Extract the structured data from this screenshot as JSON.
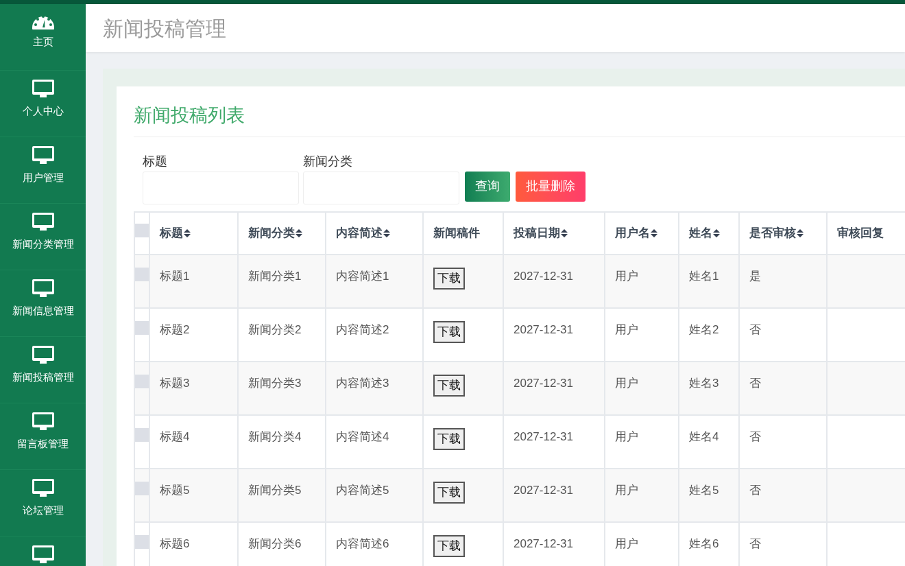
{
  "sidebar": {
    "items": [
      {
        "kind": "dashboard",
        "label": "主页"
      },
      {
        "kind": "monitor",
        "label": "个人中心"
      },
      {
        "kind": "monitor",
        "label": "用户管理"
      },
      {
        "kind": "monitor",
        "label": "新闻分类管理"
      },
      {
        "kind": "monitor",
        "label": "新闻信息管理"
      },
      {
        "kind": "monitor",
        "label": "新闻投稿管理"
      },
      {
        "kind": "monitor",
        "label": "留言板管理"
      },
      {
        "kind": "monitor",
        "label": "论坛管理"
      },
      {
        "kind": "monitor"
      }
    ]
  },
  "header": {
    "title": "新闻投稿管理"
  },
  "card": {
    "title": "新闻投稿列表",
    "filters": [
      {
        "label": "标题"
      },
      {
        "label": "新闻分类"
      }
    ],
    "buttons": [
      {
        "kind": "search",
        "label": "查询"
      },
      {
        "kind": "danger",
        "label": "批量删除"
      }
    ],
    "table": {
      "select_all": {
        "checked": false
      },
      "columns": [
        {
          "label": "标题",
          "sortable": true
        },
        {
          "label": "新闻分类",
          "sortable": true
        },
        {
          "label": "内容简述",
          "sortable": true
        },
        {
          "label": "新闻稿件",
          "sortable": false
        },
        {
          "label": "投稿日期",
          "sortable": true
        },
        {
          "label": "用户名",
          "sortable": true
        },
        {
          "label": "姓名",
          "sortable": true
        },
        {
          "label": "是否审核",
          "sortable": true
        },
        {
          "label": "审核回复",
          "sortable": false
        }
      ],
      "rows": [
        {
          "checked": false,
          "cells": [
            "标题1",
            "新闻分类1",
            "内容简述1",
            {
              "button": "下载"
            },
            "2027-12-31",
            "用户",
            "姓名1",
            "是"
          ]
        },
        {
          "checked": false,
          "cells": [
            "标题2",
            "新闻分类2",
            "内容简述2",
            {
              "button": "下载"
            },
            "2027-12-31",
            "用户",
            "姓名2",
            "否"
          ]
        },
        {
          "checked": false,
          "cells": [
            "标题3",
            "新闻分类3",
            "内容简述3",
            {
              "button": "下载"
            },
            "2027-12-31",
            "用户",
            "姓名3",
            "否"
          ]
        },
        {
          "checked": false,
          "cells": [
            "标题4",
            "新闻分类4",
            "内容简述4",
            {
              "button": "下载"
            },
            "2027-12-31",
            "用户",
            "姓名4",
            "否"
          ]
        },
        {
          "checked": false,
          "cells": [
            "标题5",
            "新闻分类5",
            "内容简述5",
            {
              "button": "下载"
            },
            "2027-12-31",
            "用户",
            "姓名5",
            "否"
          ]
        },
        {
          "checked": false,
          "cells": [
            "标题6",
            "新闻分类6",
            "内容简述6",
            {
              "button": "下载"
            },
            "2027-12-31",
            "用户",
            "姓名6",
            "否"
          ]
        }
      ]
    }
  }
}
